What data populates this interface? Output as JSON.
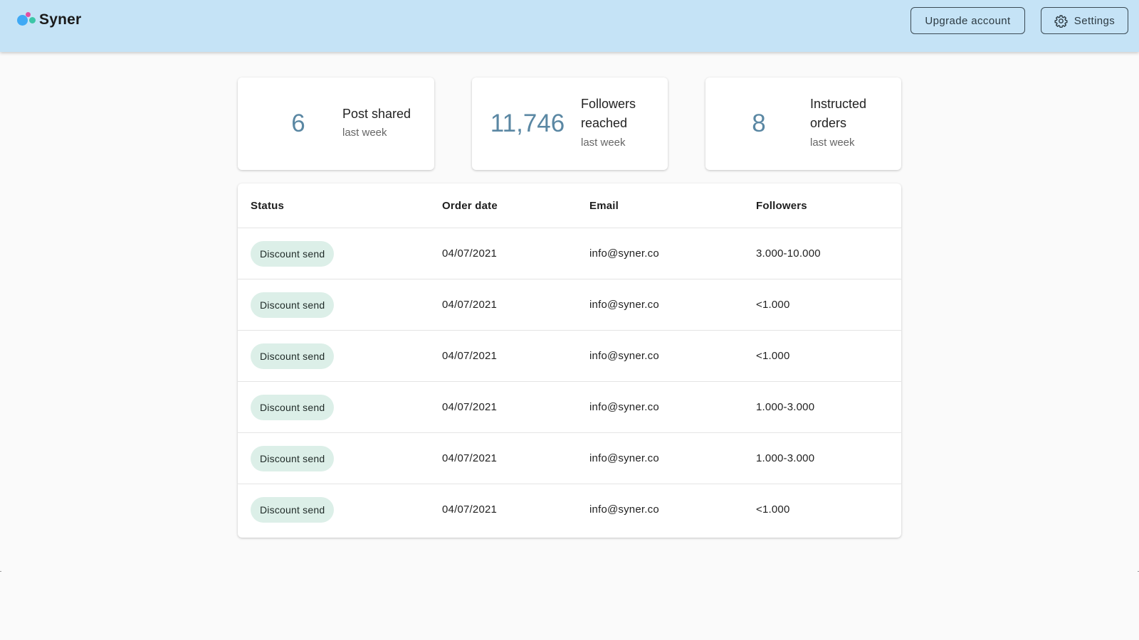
{
  "header": {
    "brand": "Syner",
    "upgrade_label": "Upgrade account",
    "settings_label": "Settings",
    "background_color": "#c5e3f6"
  },
  "stats": [
    {
      "value": "6",
      "label": "Post shared",
      "sublabel": "last week"
    },
    {
      "value": "11,746",
      "label": "Followers reached",
      "sublabel": "last week"
    },
    {
      "value": "8",
      "label": "Instructed orders",
      "sublabel": "last week"
    }
  ],
  "table": {
    "columns": [
      "Status",
      "Order date",
      "Email",
      "Followers"
    ],
    "rows": [
      {
        "status": "Discount send",
        "date": "04/07/2021",
        "email": "info@syner.co",
        "followers": "3.000-10.000"
      },
      {
        "status": "Discount send",
        "date": "04/07/2021",
        "email": "info@syner.co",
        "followers": "<1.000"
      },
      {
        "status": "Discount send",
        "date": "04/07/2021",
        "email": "info@syner.co",
        "followers": "<1.000"
      },
      {
        "status": "Discount send",
        "date": "04/07/2021",
        "email": "info@syner.co",
        "followers": "1.000-3.000"
      },
      {
        "status": "Discount send",
        "date": "04/07/2021",
        "email": "info@syner.co",
        "followers": "1.000-3.000"
      },
      {
        "status": "Discount send",
        "date": "04/07/2021",
        "email": "info@syner.co",
        "followers": "<1.000"
      }
    ],
    "status_chip_color": "#dcefe8"
  },
  "icons": {
    "logo": "syner-logo-icon",
    "settings": "gear-icon"
  },
  "colors": {
    "metric": "#5a87a3",
    "page_background": "#fafafa"
  }
}
